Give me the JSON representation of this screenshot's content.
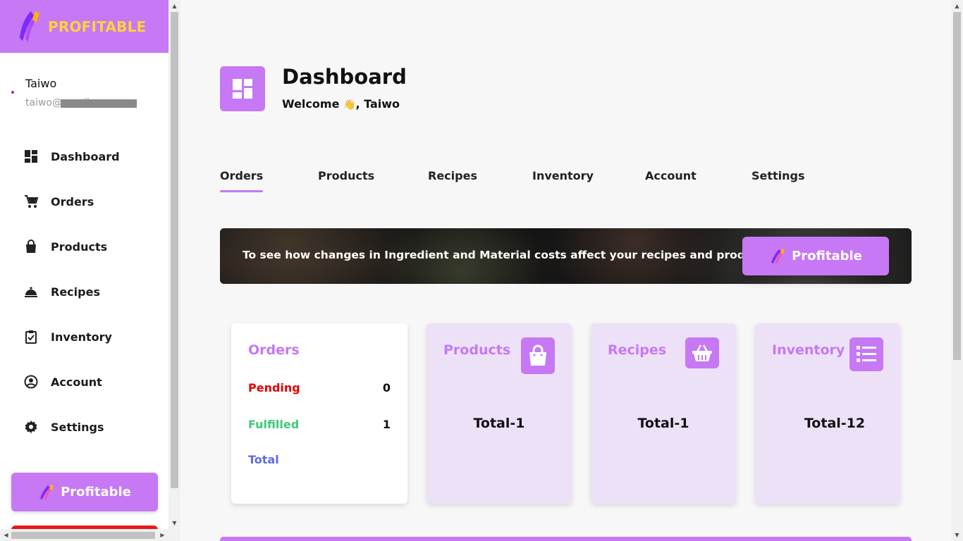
{
  "brand": {
    "name": "PROFITABLE"
  },
  "user": {
    "name": "Taiwo",
    "email": "taiwo@gmail.com"
  },
  "sidebar": {
    "items": [
      {
        "label": "Dashboard",
        "icon": "dashboard-icon"
      },
      {
        "label": "Orders",
        "icon": "cart-icon"
      },
      {
        "label": "Products",
        "icon": "bag-icon"
      },
      {
        "label": "Recipes",
        "icon": "cloche-icon"
      },
      {
        "label": "Inventory",
        "icon": "clipboard-check-icon"
      },
      {
        "label": "Account",
        "icon": "account-circle-icon"
      },
      {
        "label": "Settings",
        "icon": "gear-icon"
      }
    ],
    "profitable_button": "Profitable"
  },
  "header": {
    "title": "Dashboard",
    "welcome_prefix": "Welcome",
    "welcome_emoji": "👋",
    "welcome_suffix": ", Taiwo"
  },
  "tabs": [
    {
      "label": "Orders",
      "active": true
    },
    {
      "label": "Products",
      "active": false
    },
    {
      "label": "Recipes",
      "active": false
    },
    {
      "label": "Inventory",
      "active": false
    },
    {
      "label": "Account",
      "active": false
    },
    {
      "label": "Settings",
      "active": false
    }
  ],
  "banner": {
    "text": "To see how changes in Ingredient and Material costs affect your recipes and products.",
    "button_label": "Profitable"
  },
  "cards": {
    "orders": {
      "title": "Orders",
      "pending_label": "Pending",
      "pending_value": "0",
      "fulfilled_label": "Fulfilled",
      "fulfilled_value": "1",
      "total_label": "Total"
    },
    "products": {
      "title": "Products",
      "total": "Total-1",
      "icon": "shopping-bag-icon"
    },
    "recipes": {
      "title": "Recipes",
      "total": "Total-1",
      "icon": "basket-icon"
    },
    "inventory": {
      "title": "Inventory",
      "total": "Total-12",
      "icon": "list-icon"
    }
  },
  "colors": {
    "accent": "#c678f5",
    "brand_text": "#ffd23a",
    "pending": "#e60000",
    "fulfilled": "#3fc97a",
    "total": "#5b6be0",
    "card_lavender": "#ede1f8"
  }
}
